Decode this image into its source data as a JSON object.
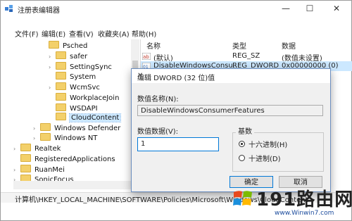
{
  "window": {
    "title": "注册表编辑器",
    "controls": {
      "minimize": "—",
      "maximize": "☐",
      "close": "✕"
    }
  },
  "menu": [
    "文件(F)",
    "编辑(E)",
    "查看(V)",
    "收藏夹(A)",
    "帮助(H)"
  ],
  "tree": {
    "items": [
      {
        "label": "Psched"
      },
      {
        "label": "safer"
      },
      {
        "label": "SettingSync"
      },
      {
        "label": "System"
      },
      {
        "label": "WcmSvc"
      },
      {
        "label": "WorkplaceJoin"
      },
      {
        "label": "WSDAPI"
      },
      {
        "label": "CloudContent"
      },
      {
        "label": "Windows Defender"
      },
      {
        "label": "Windows NT"
      },
      {
        "label": "Realtek"
      },
      {
        "label": "RegisteredApplications"
      },
      {
        "label": "RuanMei"
      },
      {
        "label": "SonicFocus"
      }
    ]
  },
  "list": {
    "headers": [
      "名称",
      "类型",
      "数据"
    ],
    "rows": [
      {
        "name": "(默认)",
        "type": "REG_SZ",
        "data": "(数值未设置)"
      },
      {
        "name": "DisableWindowsConsu...",
        "type": "REG_DWORD",
        "data": "0x00000000 (0)"
      }
    ]
  },
  "status_path": "计算机\\HKEY_LOCAL_MACHINE\\SOFTWARE\\Policies\\Microsoft\\Windows\\CloudContent",
  "dialog": {
    "title": "编辑 DWORD (32 位)值",
    "close": "✕",
    "name_label": "数值名称(N):",
    "name_value": "DisableWindowsConsumerFeatures",
    "data_label": "数值数据(V):",
    "data_value": "1",
    "base_label": "基数",
    "hex_label": "十六进制(H)",
    "dec_label": "十进制(D)",
    "selected_base": "hex",
    "ok_label": "确定",
    "cancel_label": "取消"
  },
  "watermark": {
    "text": "191路由网",
    "sub": "www.Winwin7.com"
  }
}
